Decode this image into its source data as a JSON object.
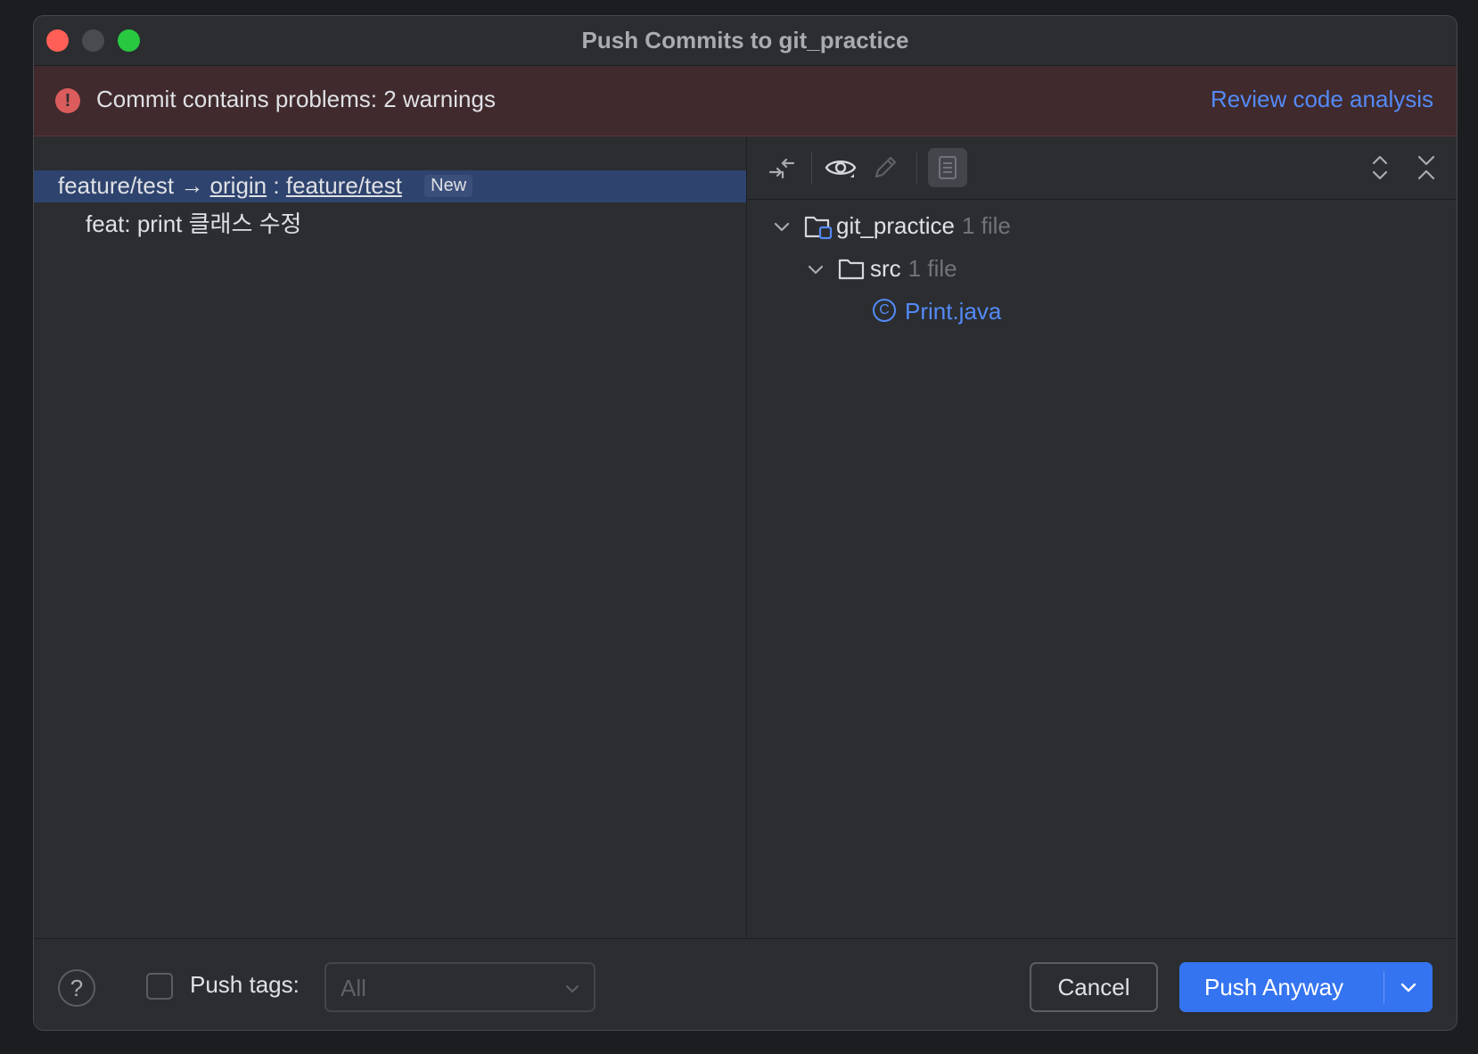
{
  "window": {
    "title": "Push Commits to git_practice"
  },
  "banner": {
    "icon": "error-icon",
    "icon_glyph": "!",
    "message": "Commit contains problems: 2 warnings",
    "link": "Review code analysis",
    "background": "#402a2d",
    "link_color": "#548af7"
  },
  "branch": {
    "local": "feature/test",
    "arrow": "→",
    "remote": "origin",
    "separator": ":",
    "target": "feature/test",
    "badge": "New"
  },
  "commits": [
    {
      "message": "feat: print 클래스 수정"
    }
  ],
  "toolbar": {
    "icons": [
      "compare-icon",
      "eye-icon",
      "edit-icon",
      "commit-details-icon",
      "expand-all-icon",
      "collapse-all-icon"
    ]
  },
  "tree": {
    "root": {
      "name": "git_practice",
      "count": "1 file"
    },
    "folder": {
      "name": "src",
      "count": "1 file"
    },
    "file": {
      "name": "Print.java",
      "icon_glyph": "C"
    }
  },
  "footer": {
    "help": "?",
    "push_tags_label": "Push tags:",
    "push_tags_checked": false,
    "push_tags_value": "All",
    "cancel": "Cancel",
    "push": "Push Anyway",
    "accent": "#3574f0"
  }
}
